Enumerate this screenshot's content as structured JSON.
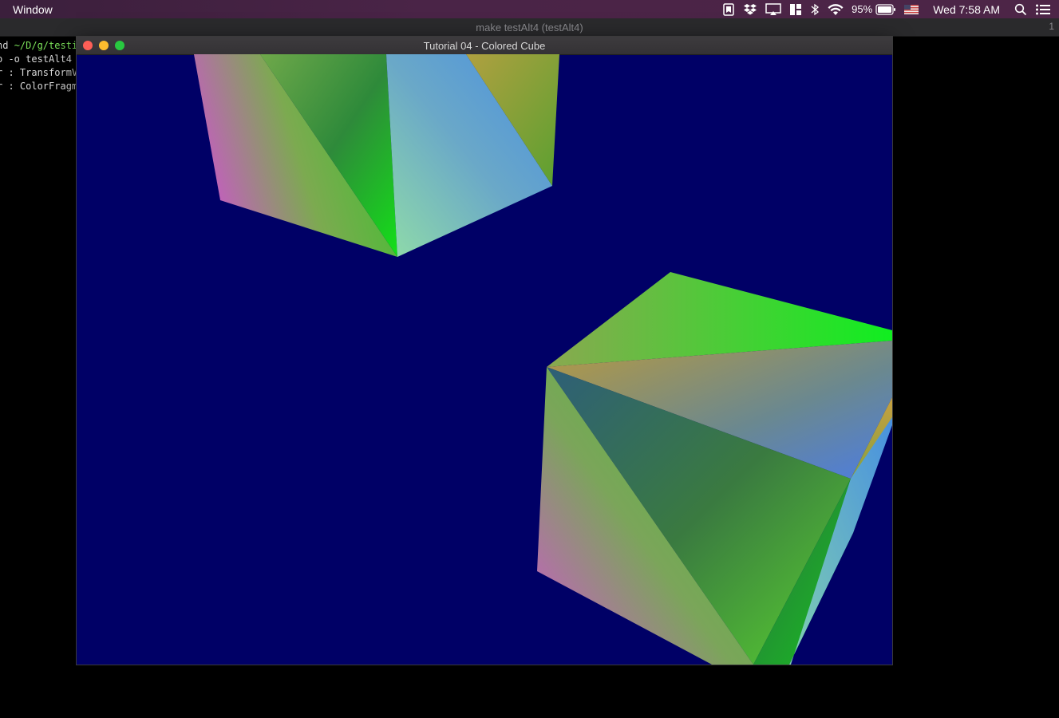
{
  "menubar": {
    "app_menu": "Window",
    "battery_percent": "95%",
    "clock": "Wed 7:58 AM"
  },
  "terminal": {
    "title": "make testAlt4 (testAlt4)",
    "tab_number": "1",
    "lines": [
      {
        "prefix": "nd ",
        "path": "~/D/g/testi"
      },
      {
        "text": "o -o testAlt4"
      },
      {
        "text": ""
      },
      {
        "text": "r : TransformV"
      },
      {
        "text": "r : ColorFragm"
      }
    ]
  },
  "gl_window": {
    "title": "Tutorial 04 - Colored Cube",
    "background_color": "#000066"
  },
  "colors": {
    "close": "#fe5f57",
    "minimize": "#febc2e",
    "maximize": "#28c840"
  },
  "icons": [
    "script-editor-icon",
    "dropbox-icon",
    "airplay-icon",
    "window-tiling-icon",
    "bluetooth-icon",
    "wifi-icon",
    "battery-icon",
    "us-flag-icon",
    "spotlight-search-icon",
    "notification-center-icon"
  ]
}
